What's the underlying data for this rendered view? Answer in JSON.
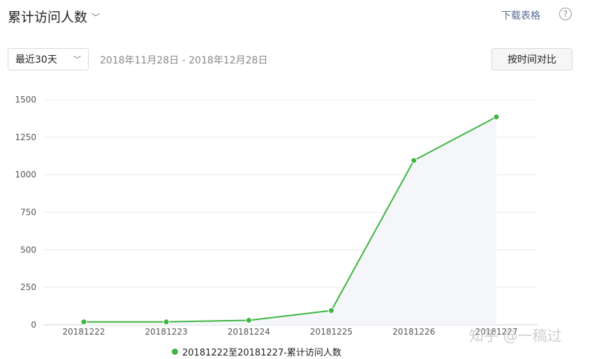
{
  "header": {
    "title": "累计访问人数",
    "download_label": "下载表格",
    "help_symbol": "?"
  },
  "controls": {
    "period_select": "最近30天",
    "date_range": "2018年11月28日 - 2018年12月28日",
    "compare_button": "按时间对比"
  },
  "watermark": "知乎 @一稿过",
  "colors": {
    "line": "#3db53f",
    "area": "#f5f6fa",
    "grid": "#ececec",
    "link": "#576b95"
  },
  "chart_data": {
    "type": "line",
    "title": "",
    "xlabel": "",
    "ylabel": "",
    "categories": [
      "20181222",
      "20181223",
      "20181224",
      "20181225",
      "20181226",
      "20181227"
    ],
    "series": [
      {
        "name": "20181222至20181227-累计访问人数",
        "values": [
          20,
          20,
          30,
          95,
          1095,
          1385
        ]
      }
    ],
    "ylim": [
      0,
      1500
    ],
    "yticks": [
      0,
      250,
      500,
      750,
      1000,
      1250,
      1500
    ],
    "grid": true,
    "legend_position": "bottom-center",
    "area_fill": true
  }
}
